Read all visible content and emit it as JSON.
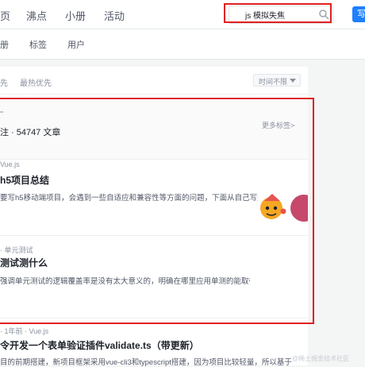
{
  "nav": {
    "items": [
      "页",
      "沸点",
      "小册",
      "活动"
    ],
    "search_value": "js 模拟失焦",
    "write_label": "写"
  },
  "subnav": {
    "items": [
      "册",
      "标签",
      "用户"
    ]
  },
  "sort": {
    "items": [
      "先",
      "最热优先"
    ],
    "time_filter": "时间不限"
  },
  "tag": {
    "line1": "\\",
    "meta": "注 · 54747 文章",
    "more": "更多标签>"
  },
  "articles": [
    {
      "meta": "Vue.js",
      "title": "h5项目总结",
      "excerpt": "要写h5移动端项目，会遇到一些自适应和兼容性等方面的问题，下面从自己写过的h5项目中"
    },
    {
      "meta": "· 单元测试",
      "title": "测试测什么",
      "excerpt": "强调单元测试的逻辑覆盖率是没有太大意义的，明确在哪里应用单测的能取得"
    },
    {
      "meta": "· 1年前 · Vue.js",
      "title": "令开发一个表单验证插件validate.ts（带更新）",
      "excerpt": "目的前期搭建，新项目框架采用vue-cli3和typescript搭建，因为项目比较轻量，所以基于"
    }
  ],
  "watermark": "@稀土掘金技术社区",
  "colors": {
    "accent": "#1e80ff",
    "annotation": "#e02020"
  }
}
